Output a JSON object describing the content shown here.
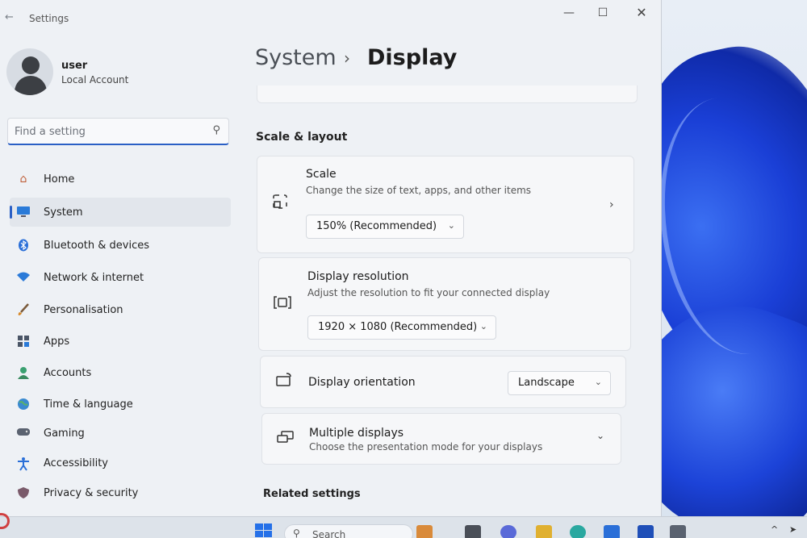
{
  "window": {
    "app_title": "Settings",
    "controls": {
      "minimize": "—",
      "maximize": "☐",
      "close": "✕"
    }
  },
  "profile": {
    "name": "user",
    "account_type": "Local Account"
  },
  "search": {
    "placeholder": "Find a setting"
  },
  "sidebar": {
    "active": "System",
    "items": [
      {
        "label": "Home",
        "icon": "home-icon"
      },
      {
        "label": "System",
        "icon": "monitor-icon"
      },
      {
        "label": "Bluetooth & devices",
        "icon": "bluetooth-icon"
      },
      {
        "label": "Network & internet",
        "icon": "wifi-icon"
      },
      {
        "label": "Personalisation",
        "icon": "brush-icon"
      },
      {
        "label": "Apps",
        "icon": "apps-icon"
      },
      {
        "label": "Accounts",
        "icon": "person-icon"
      },
      {
        "label": "Time & language",
        "icon": "globe-icon"
      },
      {
        "label": "Gaming",
        "icon": "gamepad-icon"
      },
      {
        "label": "Accessibility",
        "icon": "accessibility-icon"
      },
      {
        "label": "Privacy & security",
        "icon": "shield-icon"
      }
    ]
  },
  "breadcrumb": {
    "root": "System",
    "separator": "›",
    "current": "Display"
  },
  "sections": {
    "scale_layout": "Scale & layout",
    "related": "Related settings"
  },
  "cards": {
    "scale": {
      "title": "Scale",
      "description": "Change the size of text, apps, and other items",
      "value": "150% (Recommended)"
    },
    "resolution": {
      "title": "Display resolution",
      "description": "Adjust the resolution to fit your connected display",
      "value": "1920 × 1080 (Recommended)"
    },
    "orientation": {
      "title": "Display orientation",
      "value": "Landscape"
    },
    "multiple": {
      "title": "Multiple displays",
      "description": "Choose the presentation mode for your displays"
    }
  },
  "taskbar": {
    "search_label": "Search"
  },
  "colors": {
    "accent": "#2a5fc5",
    "window_bg": "#eef1f5",
    "card_bg": "#f6f7f9",
    "wallpaper_blue": "#1a3fd6"
  }
}
